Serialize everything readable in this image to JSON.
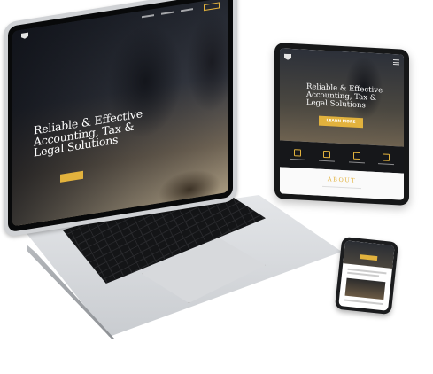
{
  "laptop": {
    "hero_title": "Reliable & Effective Accounting, Tax & Legal Solutions"
  },
  "tablet": {
    "hero_title": "Reliable & Effective Accounting, Tax & Legal Solutions",
    "cta_label": "LEARN MORE",
    "about_heading": "ABOUT"
  },
  "colors": {
    "accent_gold": "#e2b23d",
    "dark_bg": "#16171a",
    "device_silver": "#d0d2d5"
  },
  "icons": [
    "logo-shield-icon",
    "menu-icon",
    "service-icon"
  ]
}
